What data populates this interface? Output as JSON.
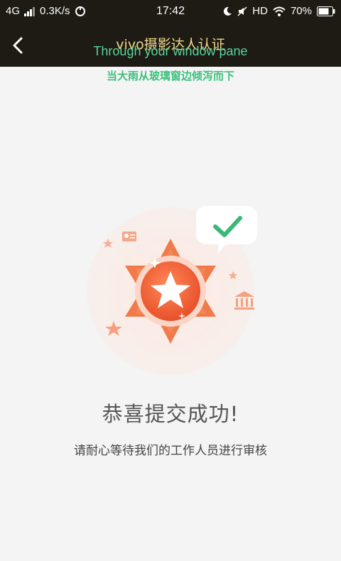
{
  "status_bar": {
    "network": "4G",
    "speed": "0.3K/s",
    "time": "17:42",
    "hd": "HD",
    "battery": "70%"
  },
  "header": {
    "title": "vivo摄影达人认证",
    "back_icon": "chevron-left-icon"
  },
  "subtitles": {
    "english": "Through your window pane",
    "chinese": "当大雨从玻璃窗边倾泻而下"
  },
  "main": {
    "headline": "恭喜提交成功!",
    "description": "请耐心等待我们的工作人员进行审核"
  },
  "colors": {
    "header_bg": "#1d1b14",
    "page_bg": "#f4f4f4",
    "badge_orange": "#f06a3c",
    "check_green": "#3cb878"
  }
}
